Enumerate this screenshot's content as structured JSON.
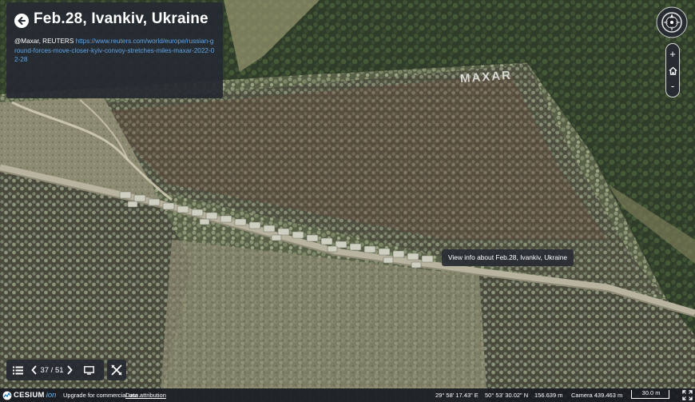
{
  "story": {
    "title": "Feb.28, Ivankiv, Ukraine",
    "credit_source": "@Maxar, REUTERS",
    "credit_link": "https://www.reuters.com/world/europe/russian-ground-forces-move-closer-kyiv-convoy-stretches-miles-maxar-2022-02-28"
  },
  "watermark": "MAXAR",
  "tooltip": "View info about Feb.28, Ivankiv, Ukraine",
  "nav": {
    "page_display": "37 / 51",
    "current_page": 37,
    "total_pages": 51
  },
  "status_bar": {
    "logo_text": "CESIUM",
    "logo_ion": "ion",
    "upgrade_text": "Upgrade for commercial use.",
    "attribution_link": "Data attribution",
    "longitude": "29° 58' 17.43\" E",
    "latitude": "50° 53' 30.02\" N",
    "height": "156.639 m",
    "camera": "Camera 439.463 m",
    "scale": "30.0 m"
  },
  "zoom": {
    "in_label": "+",
    "out_label": "-"
  },
  "icons": [
    "back-arrow-icon",
    "compass-icon",
    "home-icon",
    "list-icon",
    "chevron-left-icon",
    "chevron-right-icon",
    "presentation-icon",
    "tools-icon",
    "fullscreen-icon"
  ],
  "colors": {
    "panel_bg": "#262a32",
    "link": "#5fa4e6",
    "ion_blue": "#6fb1e8"
  }
}
